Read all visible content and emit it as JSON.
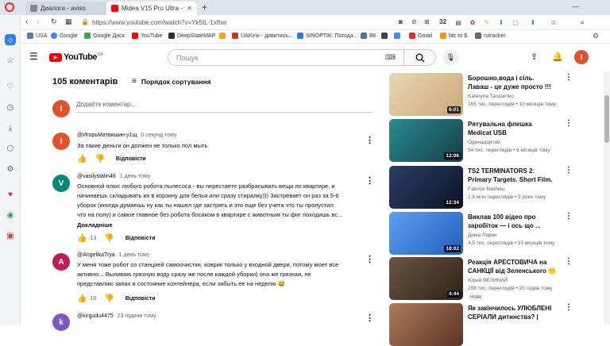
{
  "browser": {
    "tabs": [
      {
        "label": "Диалоги - aviso",
        "active": false
      },
      {
        "label": "Midea V15 Pro Ultra - ",
        "active": true
      }
    ],
    "new_tab": "+",
    "url": "https://www.youtube.com/watch?v=Yk5tL-1xfhw",
    "ext_count": "32"
  },
  "bookmarks": [
    {
      "label": "USA",
      "color": "#5a7bb5"
    },
    {
      "label": "Google",
      "color": "#4285f4"
    },
    {
      "label": "Google Диск",
      "color": "#34a853"
    },
    {
      "label": "YouTube",
      "color": "#ff0000"
    },
    {
      "label": "DeepStateMAP",
      "color": "#333"
    },
    {
      "label": "",
      "color": "#f4a020"
    },
    {
      "label": "UAKino - дивитись...",
      "color": "#c0392b"
    },
    {
      "label": "SINOPTIK: Погода...",
      "color": "#2a7de1"
    },
    {
      "label": "ВК",
      "color": "#4a76a8"
    },
    {
      "label": "",
      "color": "#444"
    },
    {
      "label": "",
      "color": "#4285f4"
    },
    {
      "label": "Gmail",
      "color": "#d93025"
    },
    {
      "label": "btc to $",
      "color": "#f7931a"
    },
    {
      "label": "rutracker",
      "color": "#666"
    }
  ],
  "youtube": {
    "logo": "YouTube",
    "region": "UA",
    "search_placeholder": "Пошук",
    "user_initial": "I"
  },
  "comments": {
    "count_label": "105 коментарів",
    "sort_label": "Порядок сортування",
    "add_placeholder": "Додайте коментар...",
    "items": [
      {
        "initial": "I",
        "color": "#e0522a",
        "author": "@ИгорьМатвишин-у1щ",
        "time": "0 секунд тому",
        "lines": [
          "За такие деньги он должен не только пол мыть"
        ],
        "likes": "",
        "more": ""
      },
      {
        "initial": "V",
        "color": "#00897b",
        "author": "@vasilystalin46",
        "time": "1 день тому",
        "lines": [
          "Основной плюс любого робота пылесоса - вы перестаете разбрасывать вещи по квартире, и",
          "начинаешь складывать их в корзину для белья или сразу стиралку))) Застревает он раз за 5-6",
          "уборок (иногда думаешь ну как ты нашел где застрять и это еще без учета что ты пропустил",
          "что на полу) и самое главное без робота босиком в квартире с животным ты фиг походишь вс..."
        ],
        "likes": "13",
        "more": "Докладніше"
      },
      {
        "initial": "A",
        "color": "#c2185b",
        "author": "@AngelikaTrya",
        "time": "1 день тому",
        "lines": [
          "У меня тоже робот со станцией самоочистки, коврик только у входной двери, потому моет все",
          "активно... Выливаю грязную воду сразу же после каждой уборки) она же грязная, не",
          "представляю запах и состояние контейнера, если забыть ее на неделю 😅"
        ],
        "likes": "10",
        "more": ""
      },
      {
        "initial": "k",
        "color": "#7e57c2",
        "author": "@kirgudu4475",
        "time": "23 години тому",
        "lines": [],
        "likes": "",
        "more": ""
      }
    ],
    "reply_label": "Відповісти"
  },
  "videos": [
    {
      "title": "Борошно,вода і сіль. Лаваш - це дуже просто !!!",
      "channel": "Kateryna Tarasenko",
      "meta": "165 тис. переглядів • 10 місяців тому",
      "duration": "6:01",
      "badge": "",
      "thumb": "#d9c6a3"
    },
    {
      "title": "Рятувальна флешка Medicat USB",
      "channel": "Одинадцятий",
      "meta": "54 тис. переглядів • 6 місяців тому",
      "duration": "12:06",
      "badge": "",
      "thumb": "#1f6f78"
    },
    {
      "title": "TS2 TERMINATORS 2: Primary Targets. Short Film.",
      "channel": "Fabrice Mathieu",
      "meta": "2,6 млн переглядів • 3 роки тому",
      "duration": "12:34",
      "badge": "",
      "thumb": "#1b2a44"
    },
    {
      "title": "Виклав 100 відео про заробіток — і ось що ...",
      "channel": "Дима Ларин",
      "meta": "4,5 тис. переглядів • 10 місяців тому",
      "duration": "18:02",
      "badge": "",
      "thumb": "#3a7bd5"
    },
    {
      "title": "Реакція АРЕСТОВИЧА на САНКЦІЇ від Зеленського 😶 ...",
      "channel": "Юрий ВЕЛИКИЙ",
      "meta": "258 тис. переглядів • 20 годин тому",
      "duration": "4:44",
      "badge": "Нове",
      "thumb": "#4a3b2e"
    },
    {
      "title": "Як закінчилось УЛЮБЛЕНІ СЕРІАЛИ дитинства? | Фінал...",
      "channel": "",
      "meta": "",
      "duration": "",
      "badge": "",
      "thumb": "#8a5a44"
    }
  ]
}
